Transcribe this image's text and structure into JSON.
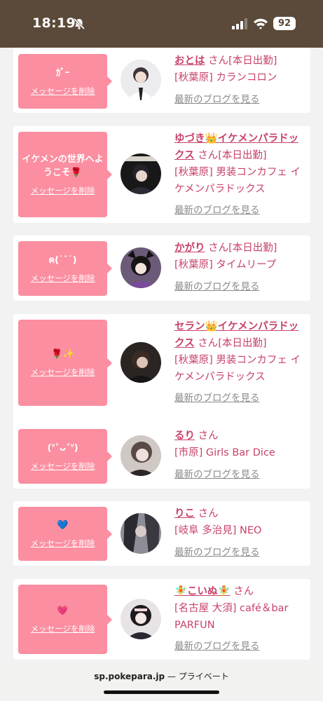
{
  "status_bar": {
    "time": "18:19",
    "battery": "92"
  },
  "cards": [
    {
      "message": "ｶﾞｰ",
      "delete_label": "メッセージを削除",
      "name": "おとは",
      "honorific": "さん",
      "status": "[本日出勤]",
      "shop": "[秋葉原] カランコロン",
      "blog_label": "最新のブログを見る"
    },
    {
      "message": "イケメンの世界へようこそ🌹",
      "delete_label": "メッセージを削除",
      "name": "ゆづき👑イケメンパラドックス",
      "honorific": "さん",
      "status": "[本日出勤]",
      "shop": "[秋葉原] 男装コンカフェ イケメンパラドックス",
      "blog_label": "最新のブログを見る"
    },
    {
      "message": "ฅ(˙˘˙)",
      "delete_label": "メッセージを削除",
      "name": "かがり",
      "honorific": "さん",
      "status": "[本日出勤]",
      "shop": "[秋葉原] タイムリープ",
      "blog_label": "最新のブログを見る"
    },
    {
      "message": "🌹✨",
      "delete_label": "メッセージを削除",
      "name": "セラン👑イケメンパラドックス",
      "honorific": "さん",
      "status": "[本日出勤]",
      "shop": "[秋葉原] 男装コンカフェ イケメンパラドックス",
      "blog_label": "最新のブログを見る"
    },
    {
      "message": "(ᐡ˃ᴗ˂ᐡ)",
      "delete_label": "メッセージを削除",
      "name": "るり",
      "honorific": "さん",
      "status": "",
      "shop": "[市原] Girls Bar Dice",
      "blog_label": "最新のブログを見る"
    },
    {
      "message": "💙",
      "delete_label": "メッセージを削除",
      "name": "りこ",
      "honorific": "さん",
      "status": "",
      "shop": "[岐阜 多治見] NEO",
      "blog_label": "最新のブログを見る"
    },
    {
      "message": "💗",
      "delete_label": "メッセージを削除",
      "name": "🧚こいぬ🧚",
      "honorific": "さん",
      "status": "",
      "shop": "[名古屋 大須] café＆bar PARFUN",
      "blog_label": "最新のブログを見る"
    }
  ],
  "browser": {
    "domain": "sp.pokepara.jp",
    "separator": " — ",
    "mode": "プライベート"
  },
  "colors": {
    "status_bar": "#5b4a39",
    "bubble": "#fb8ea0",
    "accent": "#c74268",
    "muted": "#8a8a8a"
  }
}
